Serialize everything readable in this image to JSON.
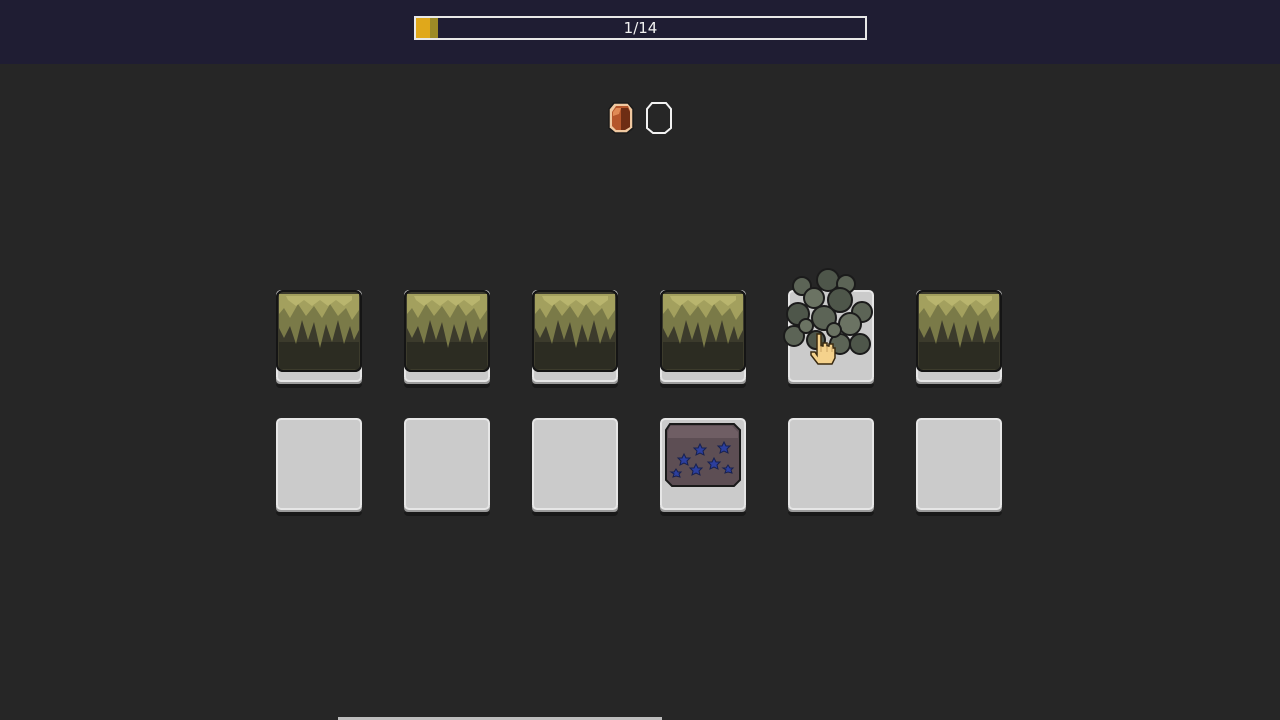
{
  "progress": {
    "label": "1/14",
    "fraction": 0.071,
    "fill_color": "#e0a81b",
    "fill_shade": "#9c8a26"
  },
  "gems": [
    {
      "icon": "amber-gem-icon",
      "state": "filled",
      "color": "#b5562b"
    },
    {
      "icon": "gem-outline-icon",
      "state": "empty",
      "color": "#ffffff"
    }
  ],
  "grid": {
    "rows": [
      [
        "moss-stone",
        "moss-stone",
        "moss-stone",
        "moss-stone",
        "rubble-pile",
        "moss-stone"
      ],
      [
        "empty",
        "empty",
        "empty",
        "star-ore-rock",
        "empty",
        "empty"
      ]
    ]
  },
  "cursor": {
    "icon": "pointing-hand-cursor-icon"
  },
  "colors": {
    "background": "#262626",
    "topbar": "#1f1d33",
    "tile": "#cbcbcb"
  }
}
